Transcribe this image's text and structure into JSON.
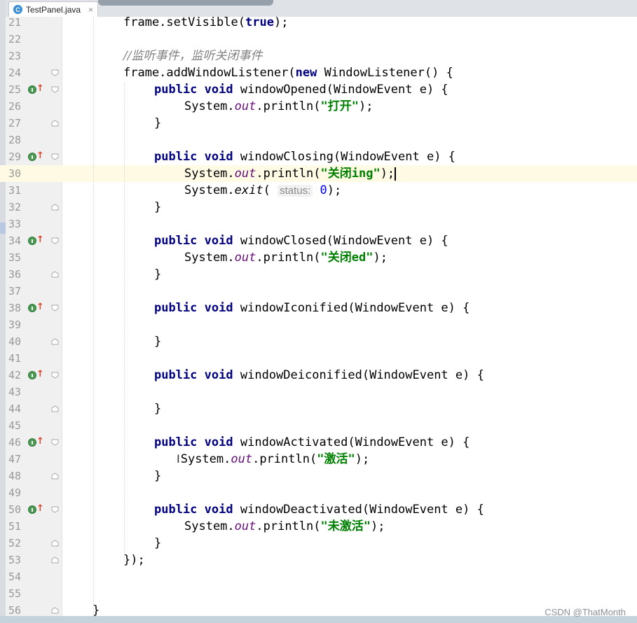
{
  "tab": {
    "title": "TestPanel.java",
    "icon": "java-class-icon",
    "close": "×"
  },
  "watermark": "CSDN @ThatMonth",
  "hint_label": "status:",
  "lines": [
    {
      "n": "21"
    },
    {
      "n": "22"
    },
    {
      "n": "23"
    },
    {
      "n": "24"
    },
    {
      "n": "25"
    },
    {
      "n": "26"
    },
    {
      "n": "27"
    },
    {
      "n": "28"
    },
    {
      "n": "29"
    },
    {
      "n": "30"
    },
    {
      "n": "31"
    },
    {
      "n": "32"
    },
    {
      "n": "33"
    },
    {
      "n": "34"
    },
    {
      "n": "35"
    },
    {
      "n": "36"
    },
    {
      "n": "37"
    },
    {
      "n": "38"
    },
    {
      "n": "39"
    },
    {
      "n": "40"
    },
    {
      "n": "41"
    },
    {
      "n": "42"
    },
    {
      "n": "43"
    },
    {
      "n": "44"
    },
    {
      "n": "45"
    },
    {
      "n": "46"
    },
    {
      "n": "47"
    },
    {
      "n": "48"
    },
    {
      "n": "49"
    },
    {
      "n": "50"
    },
    {
      "n": "51"
    },
    {
      "n": "52"
    },
    {
      "n": "53"
    },
    {
      "n": "54"
    },
    {
      "n": "55"
    },
    {
      "n": "56"
    }
  ],
  "code": {
    "l21_a": "frame.setVisible(",
    "l21_kw": "true",
    "l21_b": ");",
    "l23_cmt": "//监听事件，监听关闭事件",
    "l24_a": "frame.addWindowListener(",
    "l24_kw": "new",
    "l24_b": " WindowListener() {",
    "kw_public": "public",
    "kw_void": "void",
    "l25_b": " windowOpened(WindowEvent e) {",
    "sys": "System.",
    "out": "out",
    "println": ".println(",
    "close_paren": ");",
    "l26_str": "\"打开\"",
    "brace": "}",
    "l29_b": " windowClosing(WindowEvent e) {",
    "l30_str": "\"关闭ing\"",
    "l31_a": "System.",
    "l31_exit": "exit",
    "l31_b": "( ",
    "l31_num": "0",
    "l31_c": ");",
    "l34_b": " windowClosed(WindowEvent e) {",
    "l35_str": "\"关闭ed\"",
    "l38_b": " windowIconified(WindowEvent e) {",
    "l42_b": " windowDeiconified(WindowEvent e) {",
    "l46_b": " windowActivated(WindowEvent e) {",
    "l47_str": "\"激活\"",
    "l50_b": " windowDeactivated(WindowEvent e) {",
    "l51_str": "\"未激活\"",
    "l53": "});",
    "l56": "}"
  }
}
